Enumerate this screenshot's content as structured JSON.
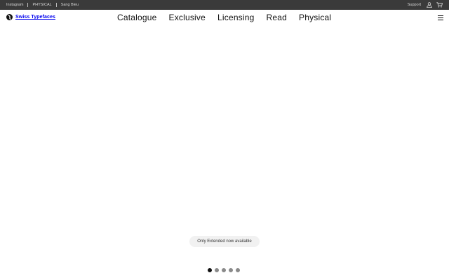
{
  "topbar": {
    "links": [
      "Instagram",
      "PHYSICAL",
      "Sang Bleu"
    ],
    "support_label": "Support",
    "account_icon": "user-icon",
    "cart_icon": "cart-icon"
  },
  "header": {
    "brand_name": "Swiss Typefaces",
    "logo_icon": "swiss-typefaces-logo",
    "nav": [
      "Catalogue",
      "Exclusive",
      "Licensing",
      "Read",
      "Physical"
    ],
    "menu_icon": "hamburger-menu-icon"
  },
  "hero": {
    "badge_text": "Only Extended now available",
    "slide_count": 5,
    "active_slide": 1
  },
  "colors": {
    "topbar_bg": "#3a3a3a",
    "topbar_text": "#d8d8d8",
    "page_bg": "#ffffff",
    "text": "#111111",
    "badge_bg": "#f1f1f1",
    "dot_inactive": "#8a8a8a"
  }
}
